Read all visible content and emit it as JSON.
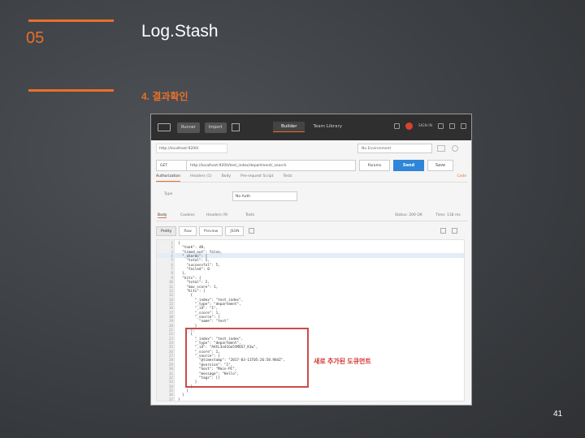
{
  "slide": {
    "number": "05",
    "title": "Log.Stash",
    "subtitle": "4. 결과확인",
    "page": "41",
    "accent": "#e8702a"
  },
  "app": {
    "toolbar": {
      "runner": "Runner",
      "import": "Import",
      "builder": "Builder",
      "team_library": "Team Library",
      "sign_in": "SIGN IN"
    },
    "tab_url": "http://localhost:9200/",
    "environment": "No Environment",
    "request": {
      "method": "GET",
      "url": "http://localhost:9200/test_index/department/_search",
      "params": "Params",
      "send": "Send",
      "save": "Save"
    },
    "request_tabs": [
      "Authorization",
      "Headers (1)",
      "Body",
      "Pre-request Script",
      "Tests"
    ],
    "code_link": "Code",
    "auth": {
      "type_label": "Type",
      "type_value": "No Auth"
    },
    "response_tabs": [
      "Body",
      "Cookies",
      "Headers (9)",
      "Tests"
    ],
    "status": "Status: 200 OK",
    "time": "Time: 118 ms",
    "format_buttons": [
      "Pretty",
      "Raw",
      "Preview",
      "JSON"
    ],
    "code_lines": [
      "{",
      "  \"took\": 48,",
      "  \"timed_out\": false,",
      "  \"_shards\": {",
      "    \"total\": 5,",
      "    \"successful\": 5,",
      "    \"failed\": 0",
      "  },",
      "  \"hits\": {",
      "    \"total\": 2,",
      "    \"max_score\": 1,",
      "    \"hits\": [",
      "      {",
      "        \"_index\": \"test_index\",",
      "        \"_type\": \"department\",",
      "        \"_id\": \"1\",",
      "        \"_score\": 1,",
      "        \"_source\": {",
      "          \"name\": \"test\"",
      "        }",
      "      },",
      "      {",
      "        \"_index\": \"test_index\",",
      "        \"_type\": \"department\",",
      "        \"_id\": \"AVtL3n41Ge5tMOS7_K1w\",",
      "        \"_score\": 1,",
      "        \"_source\": {",
      "          \"@timestamp\": \"2017-03-11T05:26:58.984Z\",",
      "          \"@version\": \"1\",",
      "          \"host\": \"Main-PC\",",
      "          \"message\": \"Hello\",",
      "          \"tags\": []",
      "        }",
      "      }",
      "    ]",
      "  }",
      "}"
    ]
  },
  "annotation": "새로 추가된 도큐먼트"
}
